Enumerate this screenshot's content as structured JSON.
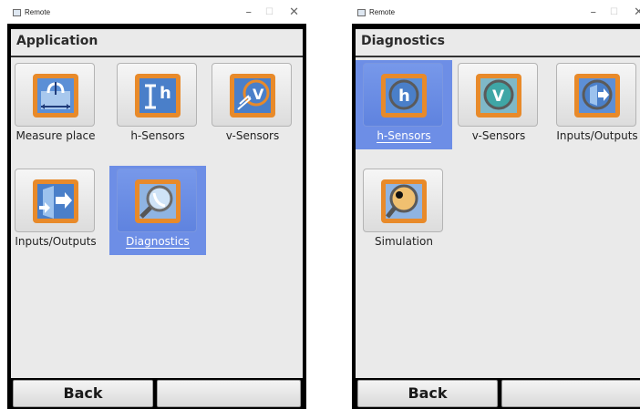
{
  "left": {
    "window_title": "Remote",
    "header": "Application",
    "tiles": [
      {
        "label": "Measure place"
      },
      {
        "label": "h-Sensors"
      },
      {
        "label": "v-Sensors"
      },
      {
        "label": "Inputs/Outputs"
      },
      {
        "label": "Diagnostics",
        "selected": true
      }
    ],
    "softkeys": {
      "back": "Back",
      "right": ""
    }
  },
  "right": {
    "window_title": "Remote",
    "header": "Diagnostics",
    "tiles": [
      {
        "label": "h-Sensors",
        "selected": true
      },
      {
        "label": "v-Sensors"
      },
      {
        "label": "Inputs/Outputs"
      },
      {
        "label": "Simulation"
      }
    ],
    "softkeys": {
      "back": "Back",
      "right": ""
    }
  },
  "window_buttons": {
    "minimize": "–",
    "maximize": "☐",
    "close": "✕"
  },
  "colors": {
    "selection": "#6d8ee6",
    "icon_orange": "#e88a2a",
    "icon_blue": "#4a7fc9"
  }
}
